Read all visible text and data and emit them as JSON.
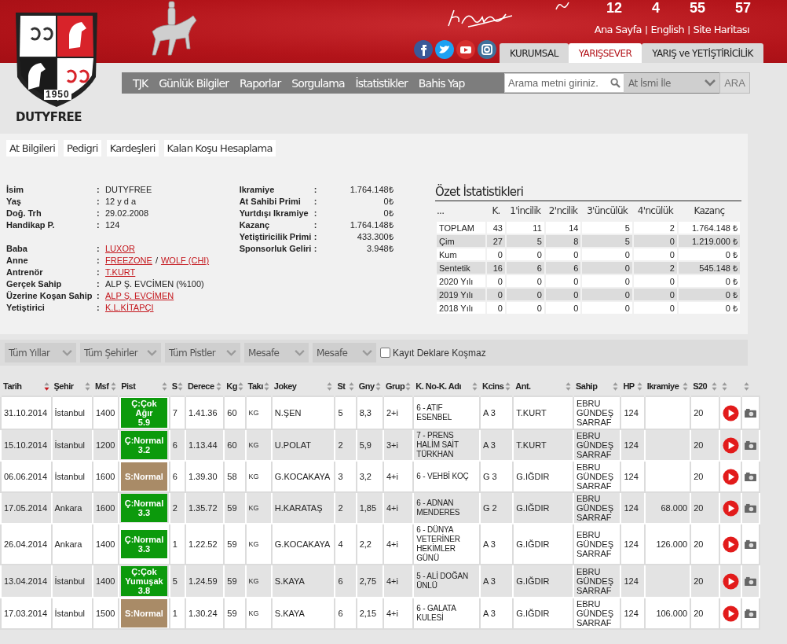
{
  "header": {
    "countdown": [
      "12",
      "4",
      "55",
      "57"
    ],
    "top_links": [
      {
        "kind": "link",
        "text": "Ana Sayfa"
      },
      {
        "kind": "separator",
        "text": "|"
      },
      {
        "kind": "link",
        "text": "English"
      },
      {
        "kind": "separator",
        "text": "|"
      },
      {
        "kind": "link",
        "text": "Site Haritası"
      }
    ],
    "social": [
      {
        "kind": "facebook"
      },
      {
        "kind": "twitter"
      },
      {
        "kind": "youtube"
      },
      {
        "kind": "instagram"
      }
    ],
    "tabs": [
      {
        "label": "KURUMSAL",
        "selected": false
      },
      {
        "label": "YARIŞSEVER",
        "selected": true
      },
      {
        "label": "YARIŞ ve YETİŞTİRİCİLİK",
        "selected": false
      }
    ],
    "logo_year": "1950",
    "horse_name": "DUTYFREE"
  },
  "nav": {
    "items": [
      "TJK",
      "Günlük Bilgiler",
      "Raporlar",
      "Sorgulama",
      "İstatistikler",
      "Bahis Yap"
    ],
    "search": {
      "placeholder": "Arama metni giriniz."
    },
    "search_mode": "At İsmi İle",
    "search_button": "ARA"
  },
  "section_tabs": [
    "At Bilgileri",
    "Pedigri",
    "Kardeşleri",
    "Kalan Koşu Hesaplama"
  ],
  "info_groups": [
    [
      {
        "label": "İsim",
        "colon": ":",
        "parts": [
          {
            "kind": "text",
            "text": "DUTYFREE"
          }
        ]
      },
      {
        "label": "Yaş",
        "colon": ":",
        "parts": [
          {
            "kind": "text",
            "text": "12 y d a"
          }
        ]
      },
      {
        "label": "Doğ. Trh",
        "colon": ":",
        "parts": [
          {
            "kind": "text",
            "text": "29.02.2008"
          }
        ]
      },
      {
        "label": "Handikap P.",
        "colon": ":",
        "parts": [
          {
            "kind": "text",
            "text": "124"
          }
        ]
      }
    ],
    [
      {
        "label": "Baba",
        "colon": ":",
        "parts": [
          {
            "kind": "link",
            "text": "LUXOR"
          }
        ]
      },
      {
        "label": "Anne",
        "colon": ":",
        "parts": [
          {
            "kind": "link",
            "text": "FREEZONE"
          },
          {
            "kind": "text",
            "text": "/"
          },
          {
            "kind": "link",
            "text": "WOLF (CHI)"
          }
        ]
      },
      {
        "label": "Antrenör",
        "colon": ":",
        "parts": [
          {
            "kind": "link",
            "text": "T.KURT"
          }
        ]
      },
      {
        "label": "Gerçek Sahip",
        "colon": ":",
        "parts": [
          {
            "kind": "text",
            "text": "ALP Ş. EVCİMEN (%100)"
          }
        ]
      },
      {
        "label": "Üzerine Koşan Sahip",
        "colon": ":",
        "parts": [
          {
            "kind": "link",
            "text": "ALP Ş. EVCİMEN"
          }
        ]
      },
      {
        "label": "Yetiştirici",
        "colon": ":",
        "parts": [
          {
            "kind": "link",
            "text": "K.L.KİTAPÇI"
          }
        ]
      }
    ]
  ],
  "earnings": [
    {
      "label": "Ikramiye",
      "colon": ":",
      "value": "1.764.148₺"
    },
    {
      "label": "At Sahibi Primi",
      "colon": ":",
      "value": "0₺"
    },
    {
      "label": "Yurtdışı Ikramiye",
      "colon": ":",
      "value": "0₺"
    },
    {
      "label": "Kazanç",
      "colon": ":",
      "value": "1.764.148₺"
    },
    {
      "label": "Yetiştiricilik Primi",
      "colon": ":",
      "value": "433.300₺"
    },
    {
      "label": "Sponsorluk Geliri",
      "colon": ":",
      "value": "3.948₺"
    }
  ],
  "summary": {
    "title": "Özet İstatistikleri",
    "columns": [
      "...",
      "K.",
      "1'incilik",
      "2'ncilik",
      "3'üncülük",
      "4'ncülük",
      "Kazanç"
    ],
    "rows": [
      [
        "TOPLAM",
        "43",
        "11",
        "14",
        "5",
        "2",
        "1.764.148 ₺"
      ],
      [
        "Çim",
        "27",
        "5",
        "8",
        "5",
        "0",
        "1.219.000 ₺"
      ],
      [
        "Kum",
        "0",
        "0",
        "0",
        "0",
        "0",
        "0 ₺"
      ],
      [
        "Sentetik",
        "16",
        "6",
        "6",
        "0",
        "2",
        "545.148 ₺"
      ],
      [
        "2020 Yılı",
        "0",
        "0",
        "0",
        "0",
        "0",
        "0 ₺"
      ],
      [
        "2019 Yılı",
        "0",
        "0",
        "0",
        "0",
        "0",
        "0 ₺"
      ],
      [
        "2018 Yılı",
        "0",
        "0",
        "0",
        "0",
        "0",
        "0 ₺"
      ]
    ]
  },
  "filters": {
    "selects": [
      "Tüm Yıllar",
      "Tüm Şehirler",
      "Tüm Pistler",
      "Mesafe",
      "Mesafe"
    ],
    "checkbox": {
      "label": "Kayıt Deklare Koşmaz",
      "checked": false
    }
  },
  "races": {
    "columns": [
      {
        "label": "Tarih",
        "sorted": true
      },
      {
        "label": "Şehir",
        "sorted": false
      },
      {
        "label": "Msf",
        "sorted": false
      },
      {
        "label": "Pist",
        "sorted": false
      },
      {
        "label": "S",
        "sorted": false
      },
      {
        "label": "Derece",
        "sorted": false
      },
      {
        "label": "Kg",
        "sorted": false
      },
      {
        "label": "Takı",
        "sorted": false
      },
      {
        "label": "Jokey",
        "sorted": false
      },
      {
        "label": "St",
        "sorted": false
      },
      {
        "label": "Gny",
        "sorted": false
      },
      {
        "label": "Grup",
        "sorted": false
      },
      {
        "label": "K. No-K. Adı",
        "sorted": false
      },
      {
        "label": "Kcins",
        "sorted": false
      },
      {
        "label": "Ant.",
        "sorted": false
      },
      {
        "label": "Sahip",
        "sorted": false
      },
      {
        "label": "HP",
        "sorted": false
      },
      {
        "label": "Ikramiye",
        "sorted": false
      },
      {
        "label": "S20",
        "sorted": false
      },
      {
        "sorted": false
      },
      {
        "sorted": false
      }
    ],
    "rows": [
      {
        "date": "31.10.2014",
        "city": "İstanbul",
        "distance": "1400",
        "track": {
          "kind": "grass",
          "label": "Ç:Çok Ağır",
          "value": "5.9"
        },
        "s": "7",
        "time": "1.41.36",
        "kg": "60",
        "equipment": "KG",
        "jockey": "N.ŞEN",
        "st": "5",
        "gny": "8,3",
        "group": "2+i",
        "race": "6 - ATIF ESENBEL",
        "kcins": "A 3",
        "trainer": "T.KURT",
        "owner": "EBRU GÜNDEŞ SARRAF",
        "hp": "124",
        "s20": "20"
      },
      {
        "date": "15.10.2014",
        "city": "İstanbul",
        "distance": "1200",
        "track": {
          "kind": "grass",
          "label": "Ç:Normal",
          "value": "3.2"
        },
        "s": "6",
        "time": "1.13.44",
        "kg": "60",
        "equipment": "KG",
        "jockey": "U.POLAT",
        "st": "2",
        "gny": "5,9",
        "group": "3+i",
        "race": "7 - PRENS HALİM SAİT TÜRKHAN",
        "kcins": "A 3",
        "trainer": "T.KURT",
        "owner": "EBRU GÜNDEŞ SARRAF",
        "hp": "124",
        "s20": "20"
      },
      {
        "date": "06.06.2014",
        "city": "İstanbul",
        "distance": "1600",
        "track": {
          "kind": "synthetic",
          "label": "S:Normal"
        },
        "s": "6",
        "time": "1.39.30",
        "kg": "58",
        "equipment": "KG",
        "jockey": "G.KOCAKAYA",
        "st": "3",
        "gny": "3,2",
        "group": "4+i",
        "race": "6 - VEHBİ KOÇ",
        "kcins": "G 3",
        "trainer": "G.IĞDIR",
        "owner": "EBRU GÜNDEŞ SARRAF",
        "hp": "124",
        "s20": "20"
      },
      {
        "date": "17.05.2014",
        "city": "Ankara",
        "distance": "1600",
        "track": {
          "kind": "grass",
          "label": "Ç:Normal",
          "value": "3.3"
        },
        "s": "2",
        "time": "1.35.72",
        "kg": "59",
        "equipment": "KG",
        "jockey": "H.KARATAŞ",
        "st": "2",
        "gny": "1,85",
        "group": "4+i",
        "race": "6 - ADNAN MENDERES",
        "kcins": "G 2",
        "trainer": "G.IĞDIR",
        "owner": "EBRU GÜNDEŞ SARRAF",
        "hp": "124",
        "prize": "68.000",
        "s20": "20"
      },
      {
        "date": "26.04.2014",
        "city": "Ankara",
        "distance": "1400",
        "track": {
          "kind": "grass",
          "label": "Ç:Normal",
          "value": "3.3"
        },
        "s": "1",
        "time": "1.22.52",
        "kg": "59",
        "equipment": "KG",
        "jockey": "G.KOCAKAYA",
        "st": "4",
        "gny": "2,2",
        "group": "4+i",
        "race": "6 - DÜNYA VETERİNER HEKİMLER GÜNÜ",
        "kcins": "A 3",
        "trainer": "G.IĞDIR",
        "owner": "EBRU GÜNDEŞ SARRAF",
        "hp": "124",
        "prize": "126.000",
        "s20": "20"
      },
      {
        "date": "13.04.2014",
        "city": "İstanbul",
        "distance": "1400",
        "track": {
          "kind": "grass",
          "label": "Ç:Çok Yumuşak",
          "value": "3.8"
        },
        "s": "5",
        "time": "1.24.59",
        "kg": "59",
        "equipment": "KG",
        "jockey": "S.KAYA",
        "st": "6",
        "gny": "2,75",
        "group": "4+i",
        "race": "5 - ALİ DOĞAN ÜNLÜ",
        "kcins": "A 3",
        "trainer": "G.IĞDIR",
        "owner": "EBRU GÜNDEŞ SARRAF",
        "hp": "124",
        "s20": "20"
      },
      {
        "date": "17.03.2014",
        "city": "İstanbul",
        "distance": "1500",
        "track": {
          "kind": "synthetic",
          "label": "S:Normal"
        },
        "s": "1",
        "time": "1.30.24",
        "kg": "59",
        "equipment": "KG",
        "jockey": "S.KAYA",
        "st": "6",
        "gny": "2,15",
        "group": "4+i",
        "race": "6 - GALATA KULESİ",
        "kcins": "A 3",
        "trainer": "G.IĞDIR",
        "owner": "EBRU GÜNDEŞ SARRAF",
        "hp": "124",
        "prize": "106.000",
        "s20": "20"
      }
    ]
  }
}
